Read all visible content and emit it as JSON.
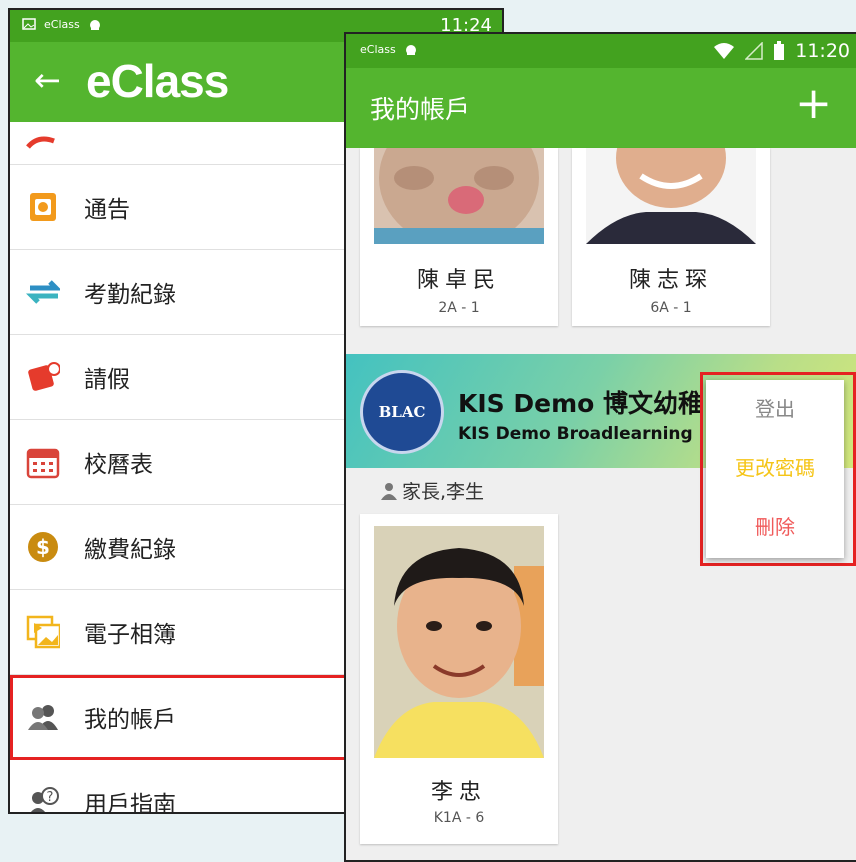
{
  "left_phone": {
    "status_app": "eClass",
    "status_time": "11:24",
    "logo_text": "eClass",
    "menu_items": [
      {
        "label": "",
        "icon": "notebook-icon"
      },
      {
        "label": "通告",
        "icon": "notice-icon"
      },
      {
        "label": "考勤紀錄",
        "icon": "attendance-icon"
      },
      {
        "label": "請假",
        "icon": "leave-icon"
      },
      {
        "label": "校曆表",
        "icon": "calendar-icon"
      },
      {
        "label": "繳費紀錄",
        "icon": "payment-icon"
      },
      {
        "label": "電子相簿",
        "icon": "album-icon"
      },
      {
        "label": "我的帳戶",
        "icon": "account-icon",
        "selected": true
      },
      {
        "label": "用戶指南",
        "icon": "help-icon"
      }
    ]
  },
  "right_phone": {
    "status_app": "eClass",
    "status_time": "11:20",
    "title": "我的帳戶",
    "add_label": "+",
    "students_top": [
      {
        "name": "陳卓民",
        "class": "2A - 1"
      },
      {
        "name": "陳志琛",
        "class": "6A - 1"
      }
    ],
    "school": {
      "seal_text": "BLAC",
      "name": "KIS Demo 博文幼稚",
      "name_en": "KIS Demo Broadlearning"
    },
    "user_line": "家長,李生",
    "student_bottom": {
      "name": "李忠",
      "class": "K1A - 6"
    },
    "popup": [
      {
        "label": "登出",
        "color": "#888888"
      },
      {
        "label": "更改密碼",
        "color": "#f5c518"
      },
      {
        "label": "刪除",
        "color": "#f05a5a"
      }
    ]
  },
  "colors": {
    "status_green": "#43a21f",
    "appbar_green": "#54b52f",
    "highlight_red": "#e52222"
  }
}
